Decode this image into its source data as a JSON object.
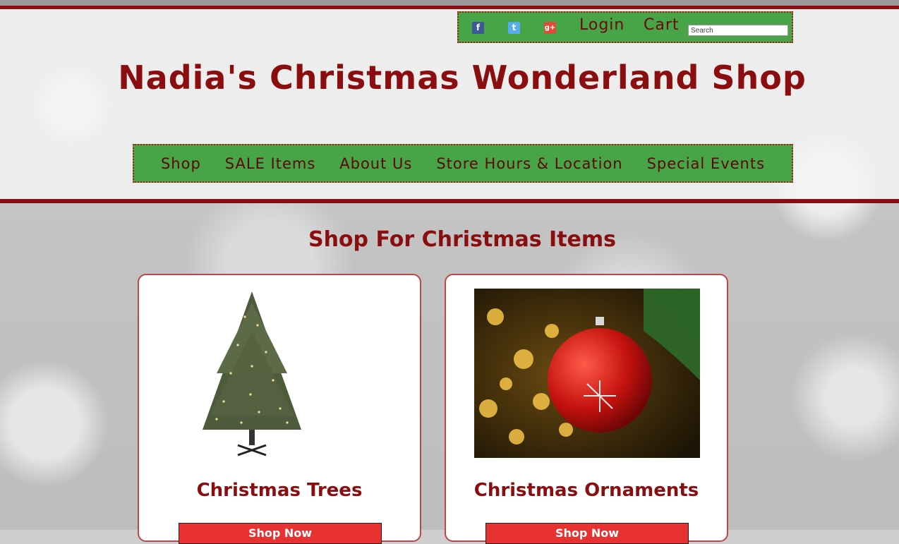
{
  "utility": {
    "social": [
      {
        "name": "facebook",
        "glyph": "f"
      },
      {
        "name": "twitter",
        "glyph": "t"
      },
      {
        "name": "google-plus",
        "glyph": "g+"
      }
    ],
    "login_label": "Login",
    "cart_label": "Cart",
    "search_placeholder": "Search"
  },
  "site": {
    "title": "Nadia's Christmas Wonderland Shop"
  },
  "nav": {
    "items": [
      "Shop",
      "SALE Items",
      "About Us",
      "Store Hours & Location",
      "Special Events"
    ]
  },
  "main": {
    "section_title": "Shop For Christmas Items",
    "cards": [
      {
        "title": "Christmas Trees",
        "image": "christmas-tree-image",
        "button": "Shop Now"
      },
      {
        "title": "Christmas Ornaments",
        "image": "christmas-ornament-image",
        "button": "Shop Now"
      }
    ]
  },
  "colors": {
    "brand_red": "#8a0d10",
    "nav_green": "#47a447",
    "button_red": "#e83232"
  }
}
